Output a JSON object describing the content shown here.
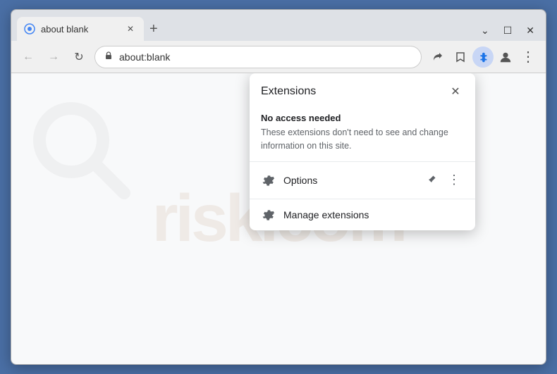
{
  "window": {
    "title": "about:blank",
    "controls": {
      "minimize": "—",
      "maximize": "☐",
      "close": "✕"
    }
  },
  "tab": {
    "label": "about blank",
    "favicon": "⊙",
    "close_label": "✕",
    "new_tab": "+"
  },
  "address_bar": {
    "url": "about:blank",
    "lock_icon": "🔒",
    "back_icon": "←",
    "forward_icon": "→",
    "reload_icon": "↻"
  },
  "toolbar": {
    "share_icon": "⬆",
    "bookmark_icon": "☆",
    "extensions_icon": "🧩",
    "profile_icon": "👤",
    "menu_icon": "⋮",
    "chevron_down": "⌄",
    "minimize_icon": "—",
    "maximize_icon": "☐",
    "close_icon": "✕"
  },
  "watermark": {
    "text": "risk.com"
  },
  "extensions_popup": {
    "title": "Extensions",
    "close_icon": "✕",
    "section_title": "No access needed",
    "section_desc": "These extensions don't need to see and change information on this site.",
    "options_label": "Options",
    "options_icon": "⚙",
    "pin_icon": "⌖",
    "more_icon": "⋮",
    "manage_label": "Manage extensions",
    "manage_icon": "⚙"
  }
}
